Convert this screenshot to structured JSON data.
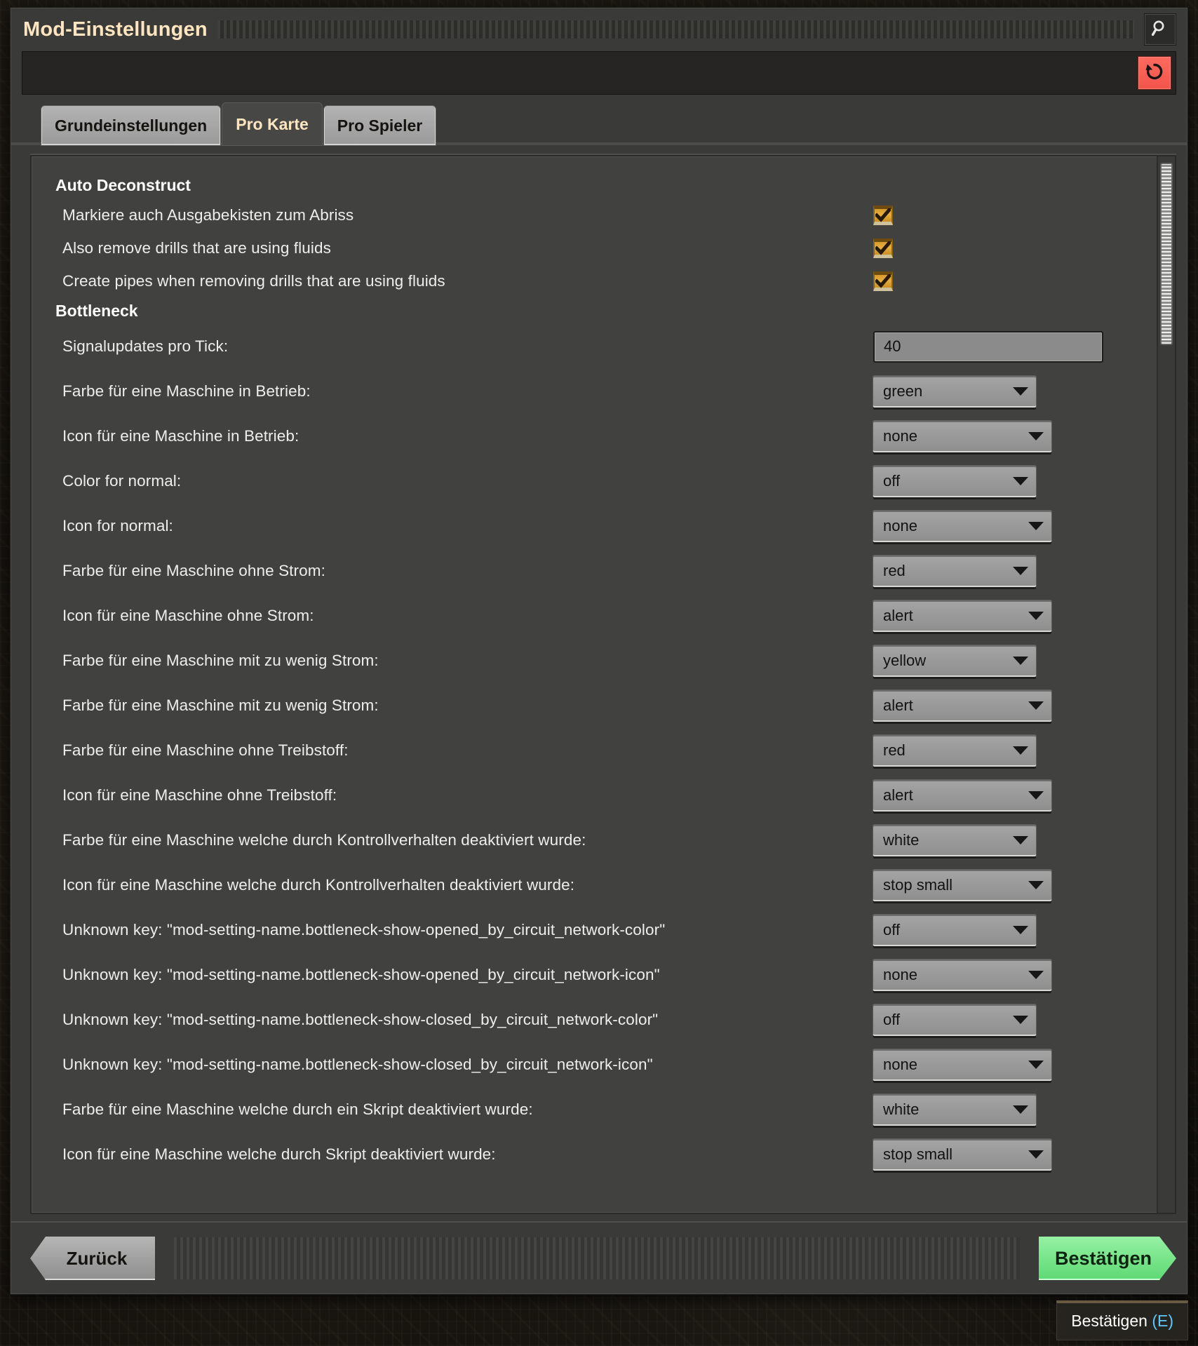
{
  "window": {
    "title": "Mod-Einstellungen",
    "search_icon": "search-icon",
    "reset_icon": "reset-undo-icon"
  },
  "tabs": [
    {
      "label": "Grundeinstellungen",
      "active": false
    },
    {
      "label": "Pro Karte",
      "active": true
    },
    {
      "label": "Pro Spieler",
      "active": false
    }
  ],
  "groups": [
    {
      "title": "Auto Deconstruct",
      "rows": [
        {
          "type": "checkbox",
          "label": "Markiere auch Ausgabekisten zum Abriss",
          "checked": true
        },
        {
          "type": "checkbox",
          "label": "Also remove drills that are using fluids",
          "checked": true
        },
        {
          "type": "checkbox",
          "label": "Create pipes when removing drills that are using fluids",
          "checked": true
        }
      ]
    },
    {
      "title": "Bottleneck",
      "rows": [
        {
          "type": "textbox",
          "label": "Signalupdates pro Tick:",
          "value": "40"
        },
        {
          "type": "dropdown",
          "label": "Farbe für eine Maschine in Betrieb:",
          "value": "green",
          "width": "color"
        },
        {
          "type": "dropdown",
          "label": "Icon für eine Maschine in Betrieb:",
          "value": "none",
          "width": "icon"
        },
        {
          "type": "dropdown",
          "label": "Color for normal:",
          "value": "off",
          "width": "color"
        },
        {
          "type": "dropdown",
          "label": "Icon for normal:",
          "value": "none",
          "width": "icon"
        },
        {
          "type": "dropdown",
          "label": "Farbe für eine Maschine ohne Strom:",
          "value": "red",
          "width": "color"
        },
        {
          "type": "dropdown",
          "label": "Icon für eine Maschine ohne Strom:",
          "value": "alert",
          "width": "icon"
        },
        {
          "type": "dropdown",
          "label": "Farbe für eine Maschine mit zu wenig Strom:",
          "value": "yellow",
          "width": "color"
        },
        {
          "type": "dropdown",
          "label": "Farbe für eine Maschine mit zu wenig Strom:",
          "value": "alert",
          "width": "icon"
        },
        {
          "type": "dropdown",
          "label": "Farbe für eine Maschine ohne Treibstoff:",
          "value": "red",
          "width": "color"
        },
        {
          "type": "dropdown",
          "label": "Icon für eine Maschine ohne Treibstoff:",
          "value": "alert",
          "width": "icon"
        },
        {
          "type": "dropdown",
          "label": "Farbe für eine Maschine welche durch Kontrollverhalten deaktiviert wurde:",
          "value": "white",
          "width": "color"
        },
        {
          "type": "dropdown",
          "label": "Icon für eine Maschine welche durch Kontrollverhalten deaktiviert wurde:",
          "value": "stop small",
          "width": "icon"
        },
        {
          "type": "dropdown",
          "label": "Unknown key: \"mod-setting-name.bottleneck-show-opened_by_circuit_network-color\"",
          "value": "off",
          "width": "color"
        },
        {
          "type": "dropdown",
          "label": "Unknown key: \"mod-setting-name.bottleneck-show-opened_by_circuit_network-icon\"",
          "value": "none",
          "width": "icon"
        },
        {
          "type": "dropdown",
          "label": "Unknown key: \"mod-setting-name.bottleneck-show-closed_by_circuit_network-color\"",
          "value": "off",
          "width": "color"
        },
        {
          "type": "dropdown",
          "label": "Unknown key: \"mod-setting-name.bottleneck-show-closed_by_circuit_network-icon\"",
          "value": "none",
          "width": "icon"
        },
        {
          "type": "dropdown",
          "label": "Farbe für eine Maschine welche durch ein Skript deaktiviert wurde:",
          "value": "white",
          "width": "color"
        },
        {
          "type": "dropdown",
          "label": "Icon für eine Maschine welche durch Skript deaktiviert wurde:",
          "value": "stop small",
          "width": "icon"
        }
      ]
    }
  ],
  "footer": {
    "back_label": "Zurück",
    "confirm_label": "Bestätigen"
  },
  "tooltip": {
    "text": "Bestätigen",
    "key": "(E)"
  },
  "colors": {
    "accent_title": "#ffe6c0",
    "confirm_green": "#76e488",
    "reset_red": "#f2544a",
    "checkbox_amber": "#e8ad3c",
    "tooltip_key_blue": "#5bc8ff"
  }
}
